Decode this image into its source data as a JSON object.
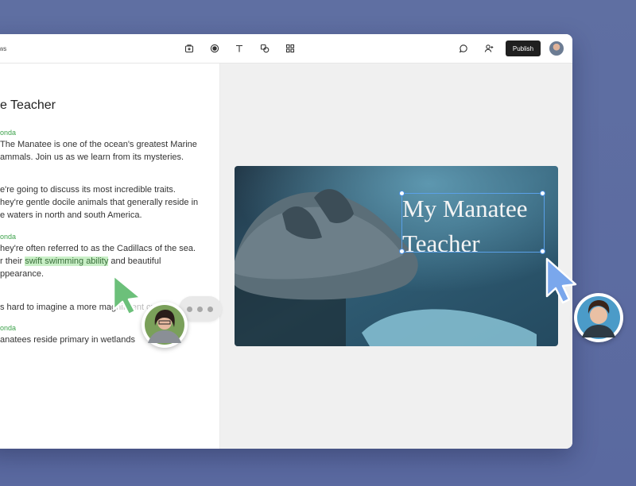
{
  "header": {
    "breadcrumb": "ows",
    "publish_label": "Publish"
  },
  "document": {
    "title": "e Teacher",
    "lines": [
      {
        "kind": "speaker",
        "text": "onda"
      },
      {
        "kind": "text",
        "text": "The Manatee is one of the ocean's greatest Marine"
      },
      {
        "kind": "text",
        "text": "ammals. Join us as we learn from its mysteries."
      },
      {
        "kind": "text",
        "text": "e're going to discuss its most incredible traits."
      },
      {
        "kind": "text",
        "text": "hey're gentle docile animals that generally reside in"
      },
      {
        "kind": "text",
        "text": "e waters in north and south America."
      },
      {
        "kind": "speaker",
        "text": "onda"
      },
      {
        "kind": "text",
        "text": "hey're often referred to as the Cadillacs of the sea."
      },
      {
        "kind": "text",
        "text_before": "r their ",
        "highlight": "swift swimming ability",
        "text_after": " and beautiful"
      },
      {
        "kind": "text",
        "text": "ppearance."
      },
      {
        "kind": "text",
        "text": "s hard to imagine a more mag",
        "text_hidden": "nificent crea"
      },
      {
        "kind": "speaker",
        "text": "onda"
      },
      {
        "kind": "text",
        "text": "anatees reside primary in wetlands"
      }
    ]
  },
  "canvas": {
    "image_title_line1": "My Manatee",
    "image_title_line2": "Teacher"
  },
  "icons": [
    "box-icon",
    "record-icon",
    "text-icon",
    "shapes-icon",
    "grid-icon",
    "comment-icon",
    "add-user-icon"
  ],
  "colors": {
    "accent_green": "#3fa34d",
    "highlight": "#c8efc6",
    "selection_blue": "#5aa0e8",
    "cursor_green": "#6cc07a",
    "cursor_blue": "#7aa7ec"
  }
}
